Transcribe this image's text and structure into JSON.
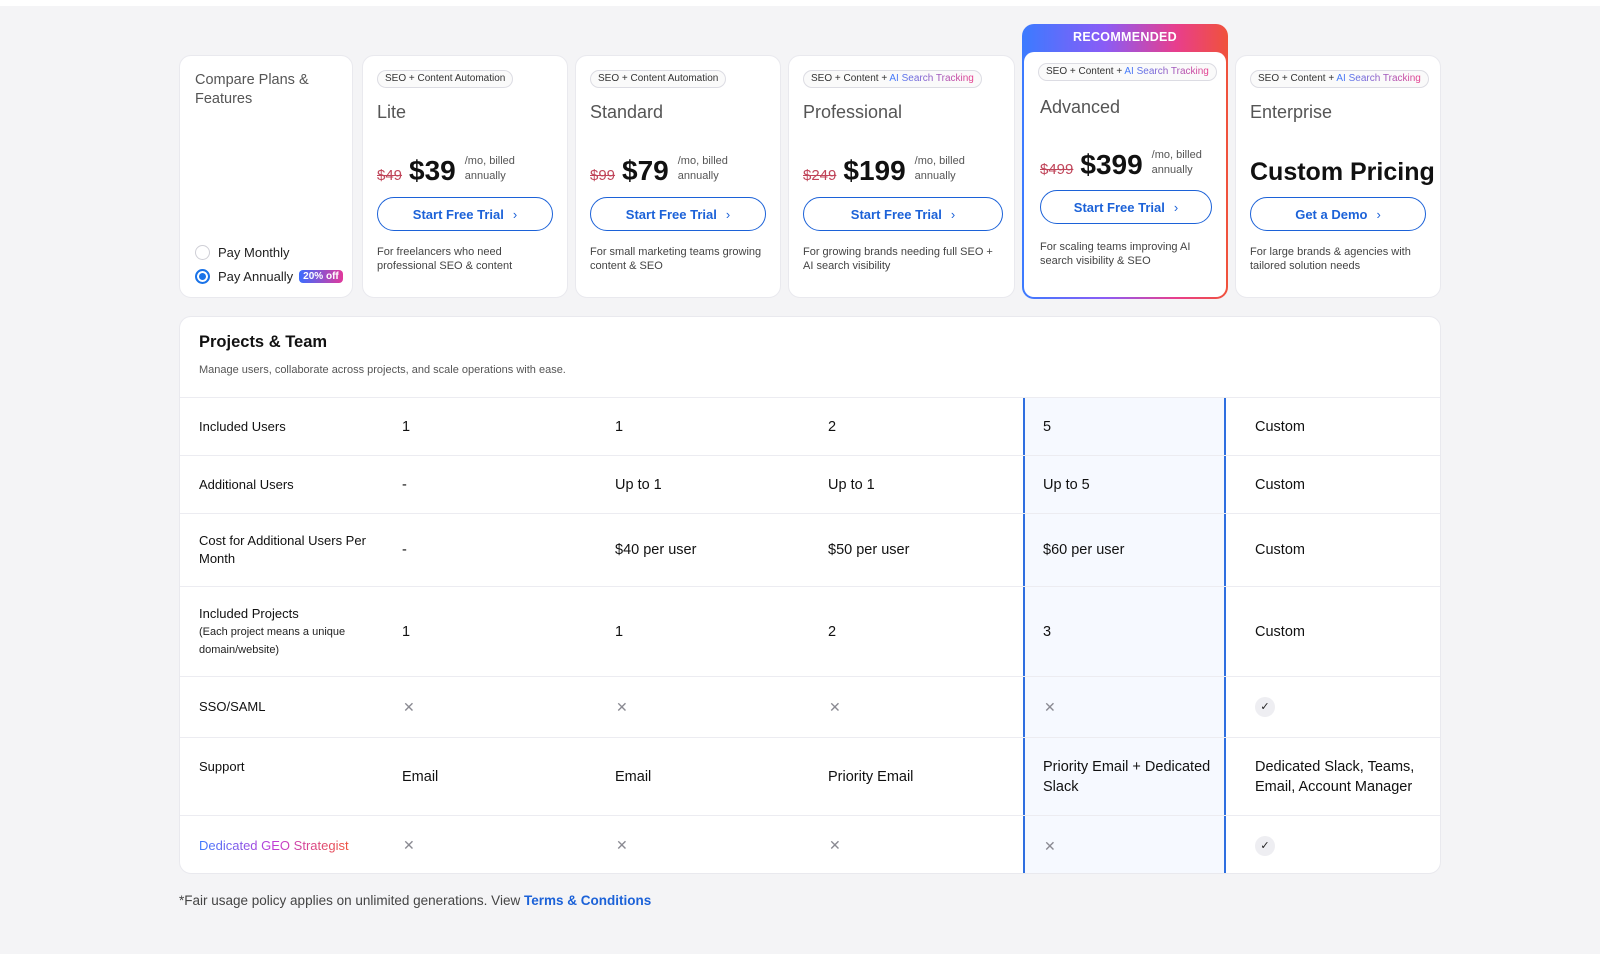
{
  "compare": {
    "title": "Compare Plans & Features",
    "billing": [
      {
        "label": "Pay Monthly",
        "selected": false
      },
      {
        "label": "Pay Annually",
        "selected": true,
        "badge": "20% off"
      }
    ]
  },
  "recommended_label": "RECOMMENDED",
  "plans": [
    {
      "tag": "SEO + Content Automation",
      "tag_extra": "",
      "name": "Lite",
      "old_price": "$49",
      "price": "$39",
      "per": "/mo, billed annually",
      "cta": "Start Free Trial",
      "desc": "For freelancers who need professional SEO & content"
    },
    {
      "tag": "SEO + Content Automation",
      "tag_extra": "",
      "name": "Standard",
      "old_price": "$99",
      "price": "$79",
      "per": "/mo, billed annually",
      "cta": "Start Free Trial",
      "desc": "For small marketing teams growing content & SEO"
    },
    {
      "tag": "SEO + Content + ",
      "tag_extra": "AI Search Tracking",
      "name": "Professional",
      "old_price": "$249",
      "price": "$199",
      "per": "/mo, billed annually",
      "cta": "Start Free Trial",
      "desc": "For growing brands needing full SEO + AI search visibility"
    },
    {
      "tag": "SEO + Content + ",
      "tag_extra": "AI Search Tracking",
      "name": "Advanced",
      "old_price": "$499",
      "price": "$399",
      "per": "/mo, billed annually",
      "cta": "Start Free Trial",
      "desc": "For scaling teams improving AI search visibility & SEO"
    },
    {
      "tag": "SEO + Content + ",
      "tag_extra": "AI Search Tracking",
      "name": "Enterprise",
      "custom_price": "Custom Pricing",
      "cta": "Get a Demo",
      "desc": "For large brands & agencies with tailored solution needs"
    }
  ],
  "section": {
    "title": "Projects & Team",
    "desc": "Manage users, collaborate across projects, and scale operations with ease."
  },
  "rows": [
    {
      "label": "Included Users",
      "values": [
        "1",
        "1",
        "2",
        "5",
        "Custom"
      ]
    },
    {
      "label": "Additional Users",
      "values": [
        "-",
        "Up to 1",
        "Up to 1",
        "Up to 5",
        "Custom"
      ]
    },
    {
      "label": "Cost for Additional Users Per Month",
      "values": [
        "-",
        "$40 per user",
        "$50 per user",
        "$60 per user",
        "Custom"
      ]
    },
    {
      "label": "Included Projects",
      "sublabel": "(Each project means a unique domain/website)",
      "values": [
        "1",
        "1",
        "2",
        "3",
        "Custom"
      ]
    },
    {
      "label": "SSO/SAML",
      "values": [
        "✕",
        "✕",
        "✕",
        "✕",
        "✓"
      ]
    },
    {
      "label": "Support",
      "values": [
        "Email",
        "Email",
        "Priority Email",
        "Priority Email + Dedicated Slack",
        "Dedicated Slack, Teams, Email, Account Manager"
      ]
    },
    {
      "label": "Dedicated GEO Strategist",
      "values": [
        "✕",
        "✕",
        "✕",
        "✕",
        "✓"
      ]
    }
  ],
  "footnote": {
    "text": "*Fair usage policy applies on unlimited generations. View ",
    "link": "Terms & Conditions"
  },
  "colors": {
    "accent": "#1c62d8",
    "highlight_border": "#2f6fe0",
    "strike": "#c0455a"
  }
}
